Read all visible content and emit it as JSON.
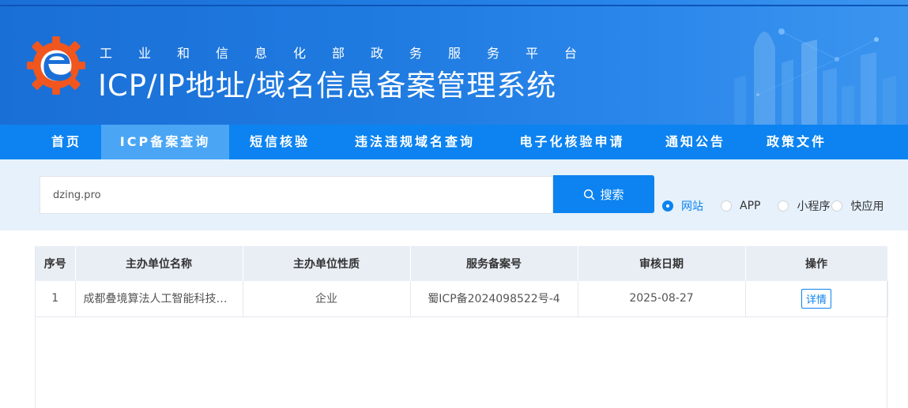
{
  "header": {
    "org_name": "工业和信息化部政务服务平台",
    "system_name": "ICP/IP地址/域名信息备案管理系统",
    "logo_icon": "gear-e-logo-icon"
  },
  "nav": {
    "items": [
      {
        "label": "首页"
      },
      {
        "label": "ICP备案查询"
      },
      {
        "label": "短信核验"
      },
      {
        "label": "违法违规域名查询"
      },
      {
        "label": "电子化核验申请"
      },
      {
        "label": "通知公告"
      },
      {
        "label": "政策文件"
      }
    ],
    "active_index": 1
  },
  "search": {
    "value": "dzing.pro",
    "button_label": "搜索",
    "button_icon": "search-icon",
    "types": [
      {
        "label": "网站",
        "checked": true
      },
      {
        "label": "APP",
        "checked": false
      },
      {
        "label": "小程序",
        "checked": false
      },
      {
        "label": "快应用",
        "checked": false
      }
    ]
  },
  "table": {
    "headers": [
      "序号",
      "主办单位名称",
      "主办单位性质",
      "服务备案号",
      "审核日期",
      "操作"
    ],
    "rows": [
      {
        "index": "1",
        "name": "成都叠境算法人工智能科技…",
        "nature": "企业",
        "record_no": "蜀ICP备2024098522号-4",
        "date": "2025-08-27",
        "action": "详情"
      }
    ]
  },
  "colors": {
    "primary": "#0c83f0",
    "nav_active": "#4aa6f5",
    "search_bg": "#e6f1fb",
    "header_row_bg": "#e9eef5"
  }
}
